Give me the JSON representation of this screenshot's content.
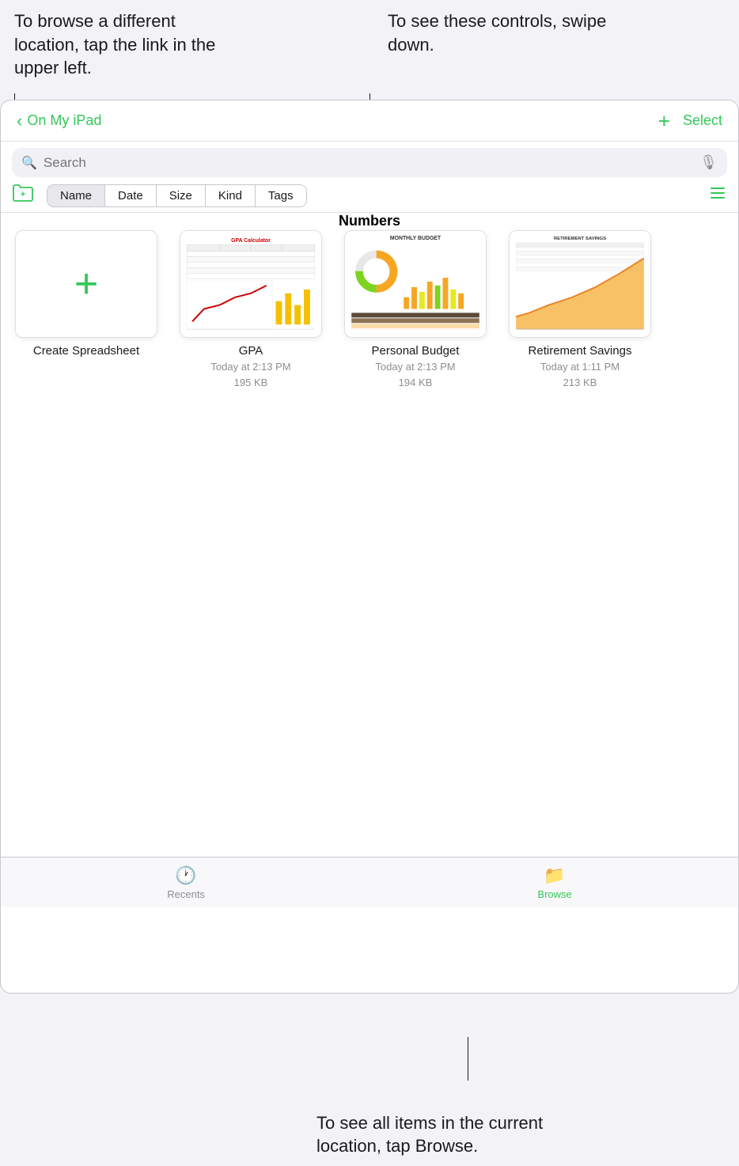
{
  "annotations": {
    "top_left": "To browse a different location, tap the link in the upper left.",
    "top_right": "To see these controls, swipe down.",
    "bottom": "To see all items in the current location, tap Browse."
  },
  "nav": {
    "back_label": "On My iPad",
    "title": "Numbers",
    "plus_label": "+",
    "select_label": "Select"
  },
  "search": {
    "placeholder": "Search"
  },
  "sort_pills": [
    {
      "label": "Name",
      "active": true
    },
    {
      "label": "Date",
      "active": false
    },
    {
      "label": "Size",
      "active": false
    },
    {
      "label": "Kind",
      "active": false
    },
    {
      "label": "Tags",
      "active": false
    }
  ],
  "files": [
    {
      "id": "create",
      "name": "Create Spreadsheet",
      "meta": "",
      "type": "create"
    },
    {
      "id": "gpa",
      "name": "GPA",
      "meta": "Today at 2:13 PM\n195 KB",
      "type": "gpa"
    },
    {
      "id": "personal_budget",
      "name": "Personal Budget",
      "meta": "Today at 2:13 PM\n194 KB",
      "type": "budget"
    },
    {
      "id": "retirement",
      "name": "Retirement Savings",
      "meta": "Today at 1:11 PM\n213 KB",
      "type": "retirement"
    }
  ],
  "tabs": [
    {
      "id": "recents",
      "label": "Recents",
      "active": false
    },
    {
      "id": "browse",
      "label": "Browse",
      "active": true
    }
  ]
}
